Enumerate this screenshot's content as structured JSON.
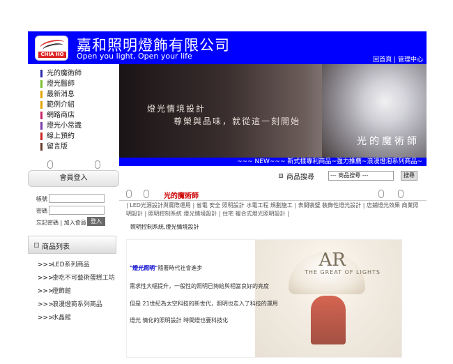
{
  "header": {
    "logo_text": "CHIA HO",
    "company_name": "嘉和照明燈飾有限公司",
    "slogan": "Open you light, Open your life",
    "links": [
      "回首頁",
      "管理中心"
    ],
    "link_separator": "|"
  },
  "left_menu": {
    "items": [
      {
        "label": "光的魔術師",
        "color": "#2a2aa8"
      },
      {
        "label": "燈光醫師",
        "color": "#7cbf2a"
      },
      {
        "label": "最新消息",
        "color": "#e0a400"
      },
      {
        "label": "範例介紹",
        "color": "#e0a400"
      },
      {
        "label": "網路商店",
        "color": "#c8246c"
      },
      {
        "label": "燈光小常識",
        "color": "#7a3ca8"
      },
      {
        "label": "線上預約",
        "color": "#c82424"
      },
      {
        "label": "留言版",
        "color": "#6a3a2a"
      }
    ]
  },
  "banner": {
    "line1": "燈光情境設計",
    "line2": "尊榮與品味，就從這一刻開始",
    "right_text": "光的魔術師"
  },
  "news": {
    "text": "~~~ NEW~~~ 新式樣專利商品~強力推薦~浪漫燈泡系列商品~"
  },
  "search": {
    "label": "商品搜尋",
    "select_value": "--- 商品搜尋 ---",
    "button_label": "搜尋"
  },
  "login": {
    "title": "會員登入",
    "account_label": "帳號",
    "password_label": "密碼",
    "forgot_label": "忘記密碼",
    "separator": "|",
    "join_label": "加入會員",
    "submit_label": "登入"
  },
  "product_list": {
    "title": "商品列表",
    "bullet": ">>>",
    "items": [
      "LED系列商品",
      "柰吃不可藝術蛋糕工坊",
      "燈飾館",
      "浪漫燈商系列商品",
      "水晶館"
    ]
  },
  "content": {
    "title": "光的魔術師",
    "categories": "| LED光源設計與實際運用 | 省電 安全 照明設計 水電工程 規劃施工 | 表間裝璧 裝飾性燈光設計 | 店鋪燈光效果 商業照明設計 | 照明控制系統 燈光情境設計 | 住宅 複合式燈光照明設計 |",
    "subtitle": "照明控制系統,燈光情境設計",
    "article": {
      "highlight": "\"燈光照明\"",
      "line1_rest": "隨著時代社會進步",
      "line2": "需求性大幅提升，一般性的照明已夠給與相當良好的亮度",
      "line3": "但是 21世紀為太空科技的新世代，照明也走入了科技的運用",
      "line4": "燈光 情化的照明設計 時間燈也要科技化",
      "product_title": "AR",
      "product_subtitle": "THE GREAT OF LIGHTS"
    }
  }
}
